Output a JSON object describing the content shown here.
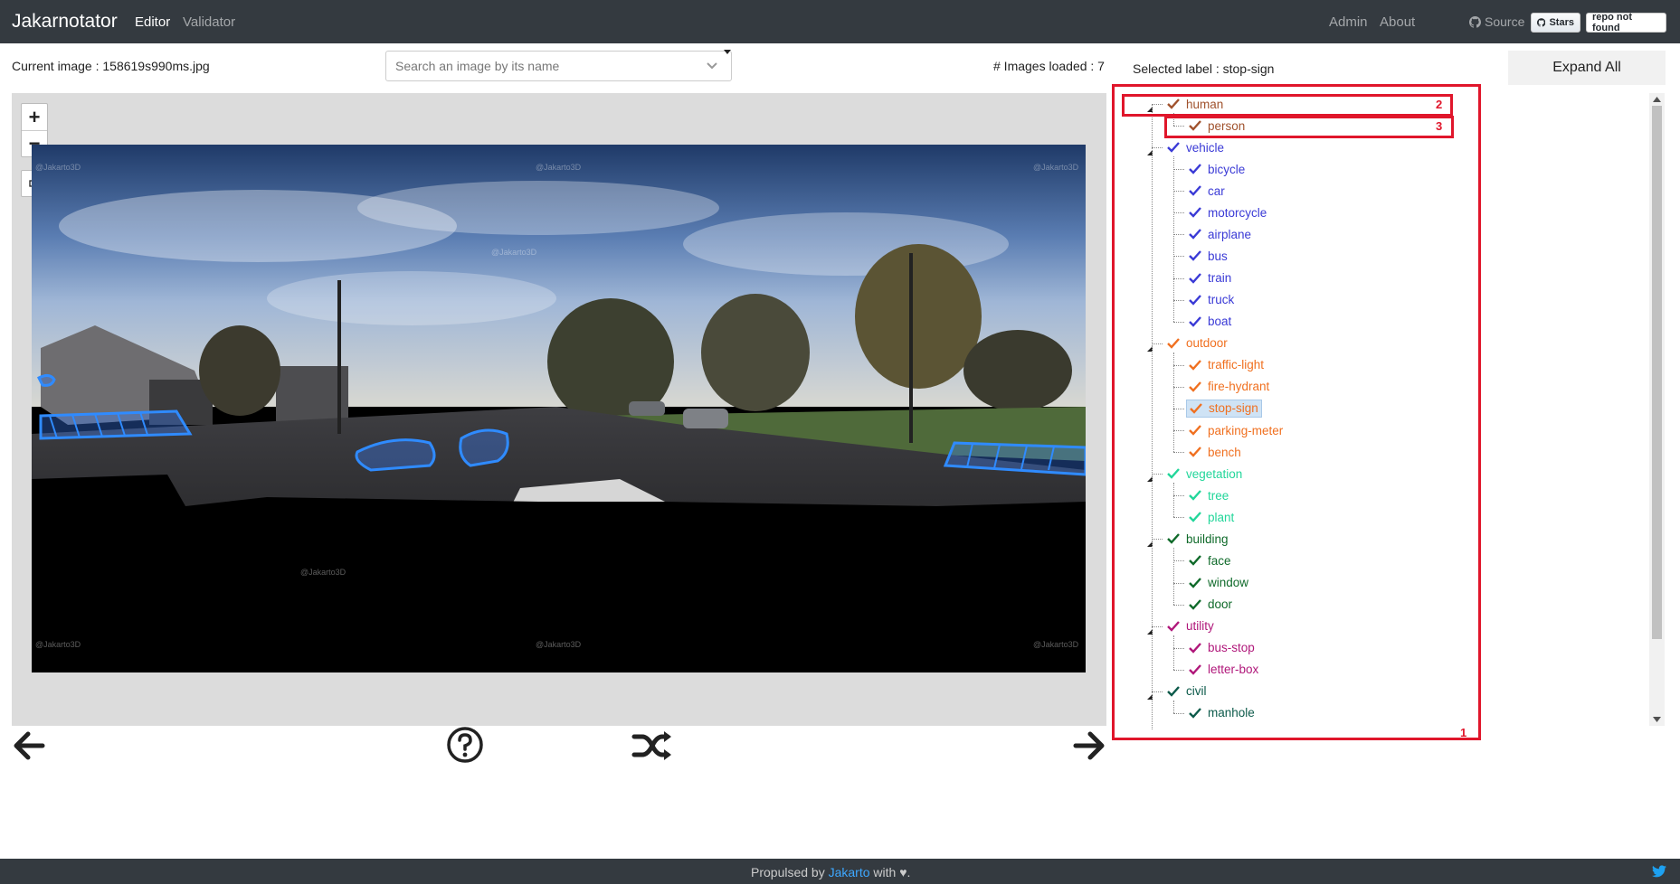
{
  "navbar": {
    "brand": "Jakarnotator",
    "links": [
      {
        "label": "Editor"
      },
      {
        "label": "Validator"
      }
    ],
    "right_links": [
      {
        "label": "Admin"
      },
      {
        "label": "About"
      }
    ],
    "source_label": "Source",
    "stars_label": "Stars",
    "stars_count": "repo not found"
  },
  "toolbar": {
    "current_image": "Current image : 158619s990ms.jpg",
    "search_placeholder": "Search an image by its name",
    "images_loaded": "# Images loaded : 7",
    "selected_label": "Selected label : stop-sign",
    "expand_all": "Expand All"
  },
  "viewer": {
    "zoom_in": "+",
    "zoom_out": "−",
    "watermark": "@Jakarto3D"
  },
  "tree": {
    "items": [
      {
        "label": "human",
        "level": 0,
        "color": "#a0522d"
      },
      {
        "label": "person",
        "level": 1,
        "color": "#a0522d"
      },
      {
        "label": "vehicle",
        "level": 0,
        "color": "#3a3ad6"
      },
      {
        "label": "bicycle",
        "level": 1,
        "color": "#3a3ad6"
      },
      {
        "label": "car",
        "level": 1,
        "color": "#3a3ad6"
      },
      {
        "label": "motorcycle",
        "level": 1,
        "color": "#3a3ad6"
      },
      {
        "label": "airplane",
        "level": 1,
        "color": "#3a3ad6"
      },
      {
        "label": "bus",
        "level": 1,
        "color": "#3a3ad6"
      },
      {
        "label": "train",
        "level": 1,
        "color": "#3a3ad6"
      },
      {
        "label": "truck",
        "level": 1,
        "color": "#3a3ad6"
      },
      {
        "label": "boat",
        "level": 1,
        "color": "#3a3ad6"
      },
      {
        "label": "outdoor",
        "level": 0,
        "color": "#f07020"
      },
      {
        "label": "traffic-light",
        "level": 1,
        "color": "#f07020"
      },
      {
        "label": "fire-hydrant",
        "level": 1,
        "color": "#f07020"
      },
      {
        "label": "stop-sign",
        "level": 1,
        "color": "#f07020",
        "selected": true
      },
      {
        "label": "parking-meter",
        "level": 1,
        "color": "#f07020"
      },
      {
        "label": "bench",
        "level": 1,
        "color": "#f07020"
      },
      {
        "label": "vegetation",
        "level": 0,
        "color": "#22d69a"
      },
      {
        "label": "tree",
        "level": 1,
        "color": "#22d69a"
      },
      {
        "label": "plant",
        "level": 1,
        "color": "#22d69a"
      },
      {
        "label": "building",
        "level": 0,
        "color": "#0f6a2a"
      },
      {
        "label": "face",
        "level": 1,
        "color": "#0f6a2a"
      },
      {
        "label": "window",
        "level": 1,
        "color": "#0f6a2a"
      },
      {
        "label": "door",
        "level": 1,
        "color": "#0f6a2a"
      },
      {
        "label": "utility",
        "level": 0,
        "color": "#b0177a"
      },
      {
        "label": "bus-stop",
        "level": 1,
        "color": "#b0177a"
      },
      {
        "label": "letter-box",
        "level": 1,
        "color": "#b0177a"
      },
      {
        "label": "civil",
        "level": 0,
        "color": "#0c5a4a"
      },
      {
        "label": "manhole",
        "level": 1,
        "color": "#0c5a4a"
      }
    ]
  },
  "annotations": [
    {
      "number": "1"
    },
    {
      "number": "2"
    },
    {
      "number": "3"
    }
  ],
  "footer": {
    "prefix": "Propulsed by ",
    "link": "Jakarto",
    "suffix": " with ♥."
  }
}
